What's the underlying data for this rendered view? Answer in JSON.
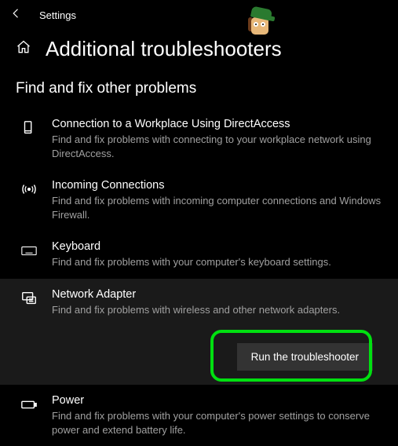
{
  "titlebar": {
    "label": "Settings"
  },
  "header": {
    "title": "Additional troubleshooters"
  },
  "section": {
    "title": "Find and fix other problems"
  },
  "items": [
    {
      "title": "Connection to a Workplace Using DirectAccess",
      "desc": "Find and fix problems with connecting to your workplace network using DirectAccess."
    },
    {
      "title": "Incoming Connections",
      "desc": "Find and fix problems with incoming computer connections and Windows Firewall."
    },
    {
      "title": "Keyboard",
      "desc": "Find and fix problems with your computer's keyboard settings."
    },
    {
      "title": "Network Adapter",
      "desc": "Find and fix problems with wireless and other network adapters."
    },
    {
      "title": "Power",
      "desc": "Find and fix problems with your computer's power settings to conserve power and extend battery life."
    }
  ],
  "run_button": {
    "label": "Run the troubleshooter"
  }
}
